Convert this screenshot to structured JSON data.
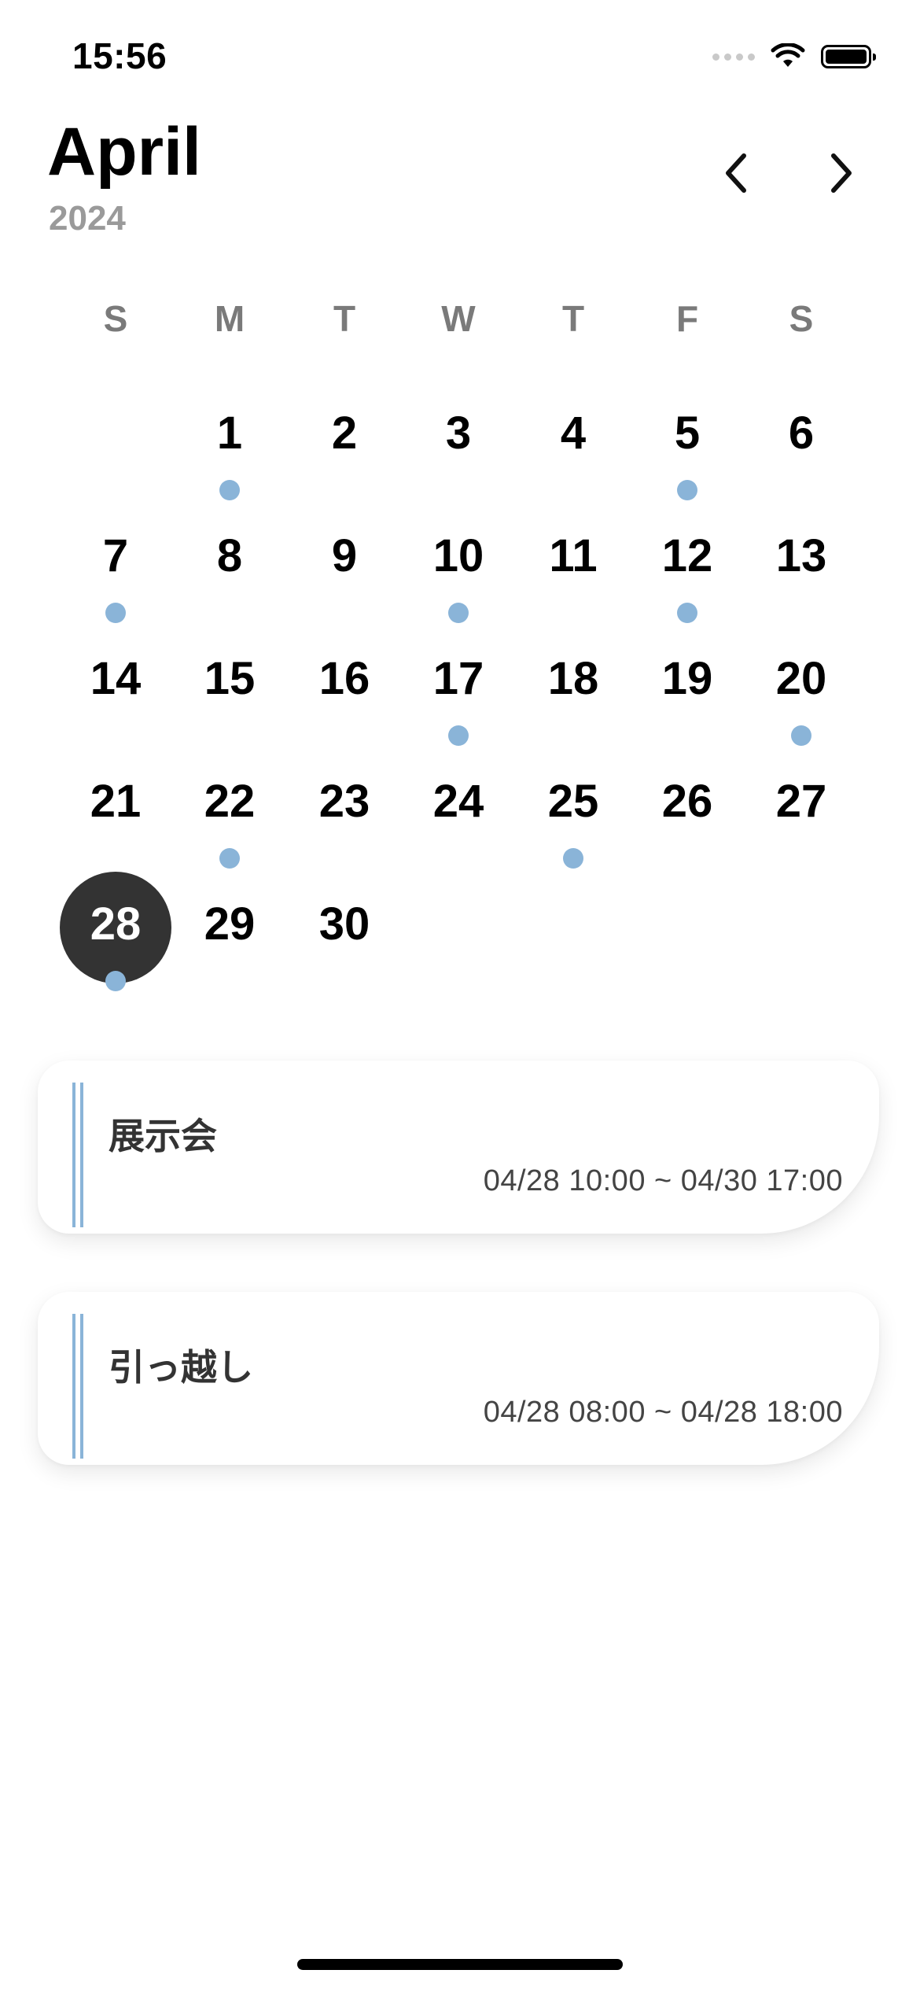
{
  "status": {
    "time": "15:56"
  },
  "header": {
    "month": "April",
    "year": "2024"
  },
  "weekdays": [
    "S",
    "M",
    "T",
    "W",
    "T",
    "F",
    "S"
  ],
  "calendar": {
    "first_weekday_index": 1,
    "days": [
      "1",
      "2",
      "3",
      "4",
      "5",
      "6",
      "7",
      "8",
      "9",
      "10",
      "11",
      "12",
      "13",
      "14",
      "15",
      "16",
      "17",
      "18",
      "19",
      "20",
      "21",
      "22",
      "23",
      "24",
      "25",
      "26",
      "27",
      "28",
      "29",
      "30"
    ],
    "event_days": [
      1,
      5,
      7,
      10,
      12,
      17,
      20,
      22,
      25,
      28
    ],
    "selected_day": 28
  },
  "events": [
    {
      "title": "展示会",
      "time": "04/28 10:00 ~ 04/30 17:00"
    },
    {
      "title": "引っ越し",
      "time": "04/28 08:00 ~ 04/28 18:00"
    }
  ],
  "colors": {
    "accent": "#8ab4d8",
    "selected": "#333333",
    "muted": "#9a9a9a"
  }
}
